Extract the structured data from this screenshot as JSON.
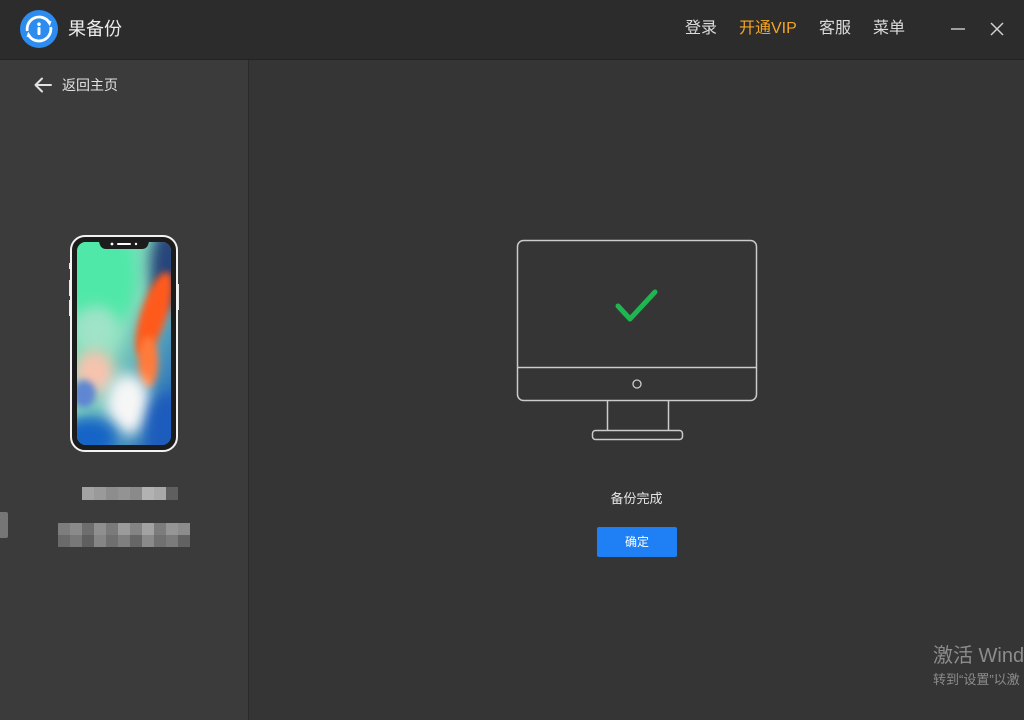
{
  "window": {
    "app_name": "果备份",
    "nav": {
      "login": "登录",
      "vip": "开通VIP",
      "service": "客服",
      "menu": "菜单"
    }
  },
  "sidebar": {
    "back_label": "返回主页"
  },
  "main": {
    "status_text": "备份完成",
    "confirm_label": "确定"
  },
  "watermark": {
    "line1": "激活 Wind",
    "line2": "转到“设置”以激"
  },
  "icons": {
    "logo": "app-logo-icon",
    "minimize": "minimize-icon",
    "close": "close-icon",
    "back": "arrow-left-icon",
    "device": "phone-illustration",
    "computer": "monitor-illustration",
    "success": "checkmark-icon"
  },
  "colors": {
    "titlebar_bg": "#2c2c2c",
    "sidebar_bg": "#3b3b3b",
    "main_bg": "#353535",
    "vip_accent": "#f5a623",
    "primary_button": "#1f7ff5",
    "success_check": "#1fb550",
    "logo_blue": "#2d8cf0"
  }
}
